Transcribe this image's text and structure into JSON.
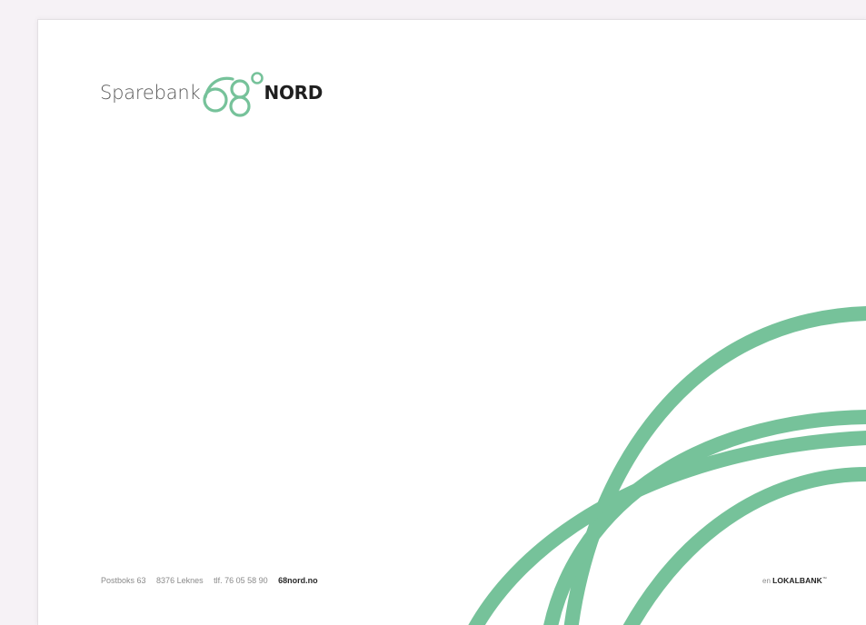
{
  "colors": {
    "accent_green": "#76c29a",
    "background": "#f6f2f6",
    "paper": "#ffffff"
  },
  "logo": {
    "bank_text": "Sparebank",
    "mark_text": "68°",
    "nord_text": "NORD"
  },
  "footer": {
    "address_line": "Postboks 63",
    "postal": "8376 Leknes",
    "phone": "tlf. 76 05 58 90",
    "website": "68nord.no"
  },
  "tagline": {
    "prefix": "en",
    "brand": "LOKALBANK",
    "mark": "™"
  }
}
